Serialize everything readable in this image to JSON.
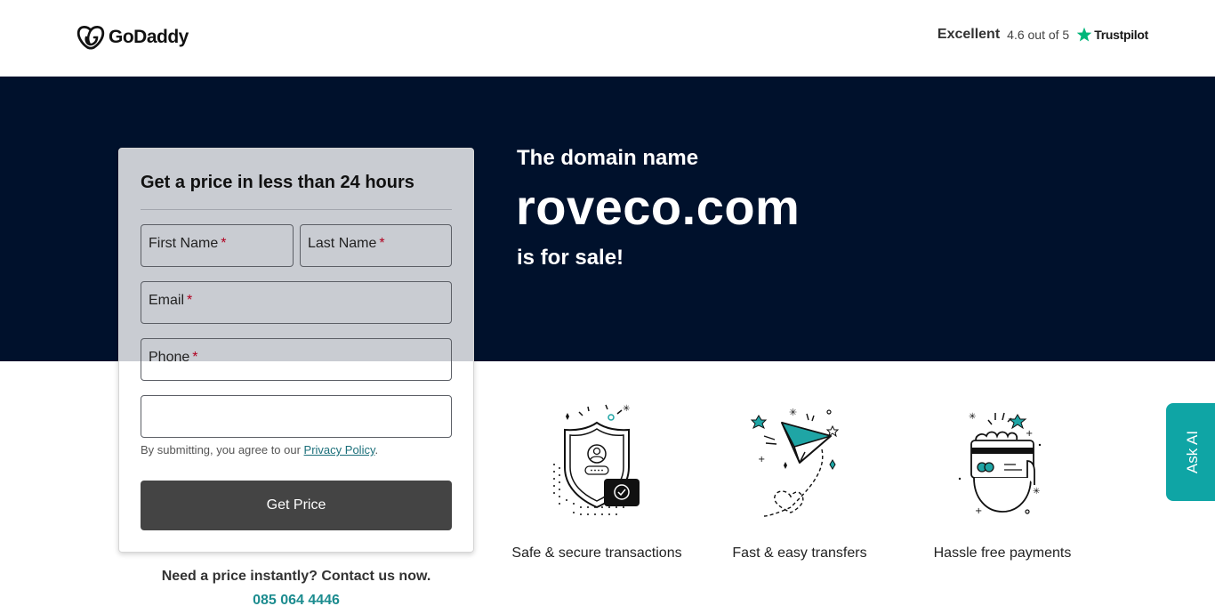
{
  "header": {
    "logo_text": "GoDaddy",
    "rating_word": "Excellent",
    "rating_score": "4.6 out of 5",
    "rating_source": "Trustpilot",
    "trustpilot_color": "#00b67a"
  },
  "hero": {
    "intro": "The domain name",
    "domain": "roveco.com",
    "outro": "is for sale!",
    "background": "#00112c"
  },
  "form": {
    "title": "Get a price in less than 24 hours",
    "fields": {
      "first_name": {
        "label": "First Name",
        "required": "*"
      },
      "last_name": {
        "label": "Last Name",
        "required": "*"
      },
      "email": {
        "label": "Email",
        "required": "*"
      },
      "phone": {
        "label": "Phone",
        "required": "*"
      },
      "extra": {
        "value": ""
      }
    },
    "consent_prefix": "By submitting, you agree to our ",
    "consent_link": "Privacy Policy",
    "consent_suffix": ".",
    "submit_label": "Get Price"
  },
  "contact": {
    "prompt": "Need a price instantly? Contact us now.",
    "phone": "085 064 4446"
  },
  "features": [
    {
      "icon": "shield-icon",
      "caption": "Safe & secure transactions"
    },
    {
      "icon": "paper-plane-icon",
      "caption": "Fast & easy transfers"
    },
    {
      "icon": "credit-card-icon",
      "caption": "Hassle free payments"
    }
  ],
  "ask_ai": {
    "label": "Ask AI",
    "color": "#0fa5a5"
  }
}
